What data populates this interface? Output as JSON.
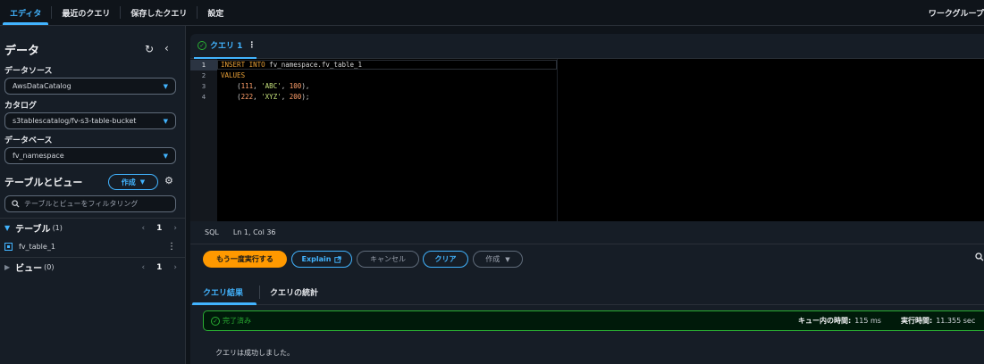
{
  "nav": {
    "tabs": [
      "エディタ",
      "最近のクエリ",
      "保存したクエリ",
      "設定"
    ],
    "active_tab": 0,
    "workgroup_label": "ワークグループ"
  },
  "sidebar": {
    "title": "データ",
    "data_source_label": "データソース",
    "data_source_value": "AwsDataCatalog",
    "catalog_label": "カタログ",
    "catalog_value": "s3tablescatalog/fv-s3-table-bucket",
    "database_label": "データベース",
    "database_value": "fv_namespace",
    "tables_views_title": "テーブルとビュー",
    "create_label": "作成",
    "filter_placeholder": "テーブルとビューをフィルタリング",
    "tables_section": {
      "title": "テーブル",
      "count": "(1)",
      "page": "1"
    },
    "table_items": [
      "fv_table_1"
    ],
    "views_section": {
      "title": "ビュー",
      "count": "(0)",
      "page": "1"
    }
  },
  "editor": {
    "tab_label": "クエリ 1",
    "line_numbers": [
      "1",
      "2",
      "3",
      "4"
    ],
    "language": "SQL",
    "cursor_position": "Ln 1, Col 36"
  },
  "actions": {
    "run_again": "もう一度実行する",
    "explain": "Explain",
    "cancel": "キャンセル",
    "clear": "クリア",
    "create": "作成"
  },
  "results": {
    "tabs": [
      "クエリ結果",
      "クエリの統計"
    ],
    "status_text": "完了済み",
    "queue_time_label": "キュー内の時間:",
    "queue_time_value": "115 ms",
    "run_time_label": "実行時間:",
    "run_time_value": "11.355 sec",
    "message": "クエリは成功しました。"
  },
  "colors": {
    "accent": "#42b4ff",
    "primary_button": "#ff9900",
    "success": "#29ad32"
  }
}
